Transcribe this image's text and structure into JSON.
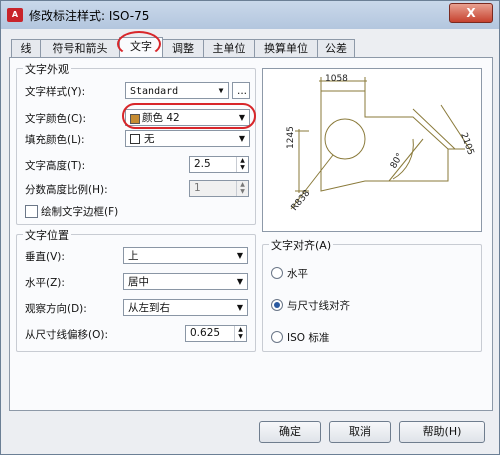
{
  "window": {
    "title": "修改标注样式: ISO-75",
    "close": "X"
  },
  "tabs": [
    "线",
    "符号和箭头",
    "文字",
    "调整",
    "主单位",
    "换算单位",
    "公差"
  ],
  "text_appearance": {
    "group": "文字外观",
    "style_label": "文字样式(Y):",
    "style_value": "Standard",
    "style_btn": "...",
    "color_label": "文字颜色(C):",
    "color_value": "颜色 42",
    "color_swatch": "#c68c32",
    "fill_label": "填充颜色(L):",
    "fill_value": "无",
    "height_label": "文字高度(T):",
    "height_value": "2.5",
    "frac_label": "分数高度比例(H):",
    "frac_value": "1",
    "frame_label": "绘制文字边框(F)"
  },
  "text_placement": {
    "group": "文字位置",
    "vertical_label": "垂直(V):",
    "vertical_value": "上",
    "horizontal_label": "水平(Z):",
    "horizontal_value": "居中",
    "view_label": "观察方向(D):",
    "view_value": "从左到右",
    "offset_label": "从尺寸线偏移(O):",
    "offset_value": "0.625"
  },
  "alignment": {
    "group": "文字对齐(A)",
    "options": [
      "水平",
      "与尺寸线对齐",
      "ISO 标准"
    ],
    "selected": 1
  },
  "preview": {
    "dim1": "1058",
    "dim2": "1245",
    "dim3": "2105",
    "angle": "80°",
    "radius": "R838"
  },
  "buttons": {
    "ok": "确定",
    "cancel": "取消",
    "help": "帮助(H)"
  }
}
